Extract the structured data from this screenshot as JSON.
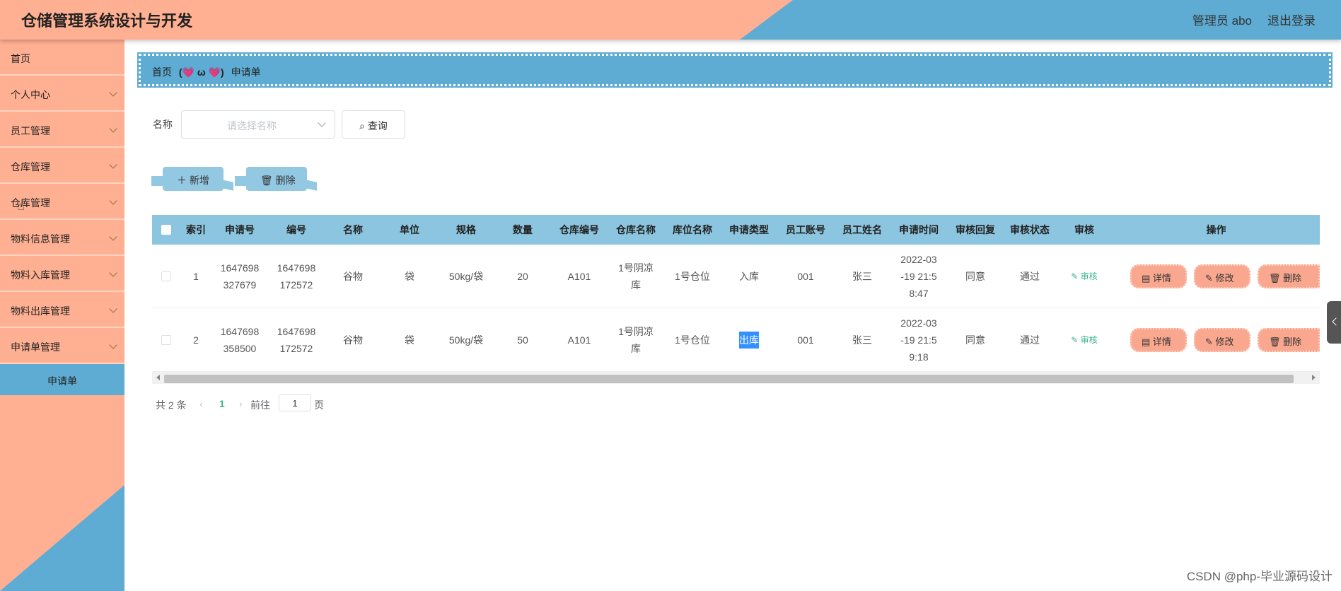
{
  "header": {
    "title": "仓储管理系统设计与开发",
    "user": "管理员 abo",
    "logout": "退出登录"
  },
  "sidebar": {
    "items": [
      {
        "label": "首页",
        "chevron": false
      },
      {
        "label": "个人中心",
        "chevron": true
      },
      {
        "label": "员工管理",
        "chevron": true
      },
      {
        "label": "仓库管理",
        "chevron": true
      },
      {
        "label": "仓库管理",
        "chevron": true
      },
      {
        "label": "物料信息管理",
        "chevron": true
      },
      {
        "label": "物料入库管理",
        "chevron": true
      },
      {
        "label": "物料出库管理",
        "chevron": true
      },
      {
        "label": "申请单管理",
        "chevron": true
      }
    ],
    "active_sub": "申请单"
  },
  "breadcrumb": {
    "home": "首页",
    "face": "(💗 ω 💗)",
    "current": "申请单"
  },
  "search": {
    "label": "名称",
    "placeholder": "请选择名称",
    "query_button": "查询"
  },
  "actions": {
    "add": "新增",
    "delete": "删除"
  },
  "table": {
    "headers": [
      "索引",
      "申请号",
      "编号",
      "名称",
      "单位",
      "规格",
      "数量",
      "仓库编号",
      "仓库名称",
      "库位名称",
      "申请类型",
      "员工账号",
      "员工姓名",
      "申请时间",
      "审核回复",
      "审核状态",
      "审核",
      "操作"
    ],
    "rows": [
      {
        "index": "1",
        "apply_no": [
          "1647698",
          "327679"
        ],
        "code": [
          "1647698",
          "172572"
        ],
        "name": "谷物",
        "unit": "袋",
        "spec": "50kg/袋",
        "qty": "20",
        "wh_code": "A101",
        "wh_name": [
          "1号阴凉",
          "库"
        ],
        "loc": "1号仓位",
        "type": "入库",
        "emp_acc": "001",
        "emp_name": "张三",
        "time": [
          "2022-03",
          "-19 21:5",
          "8:47"
        ],
        "reply": "同意",
        "status": "通过",
        "audit": "审核"
      },
      {
        "index": "2",
        "apply_no": [
          "1647698",
          "358500"
        ],
        "code": [
          "1647698",
          "172572"
        ],
        "name": "谷物",
        "unit": "袋",
        "spec": "50kg/袋",
        "qty": "50",
        "wh_code": "A101",
        "wh_name": [
          "1号阴凉",
          "库"
        ],
        "loc": "1号仓位",
        "type": "出库",
        "emp_acc": "001",
        "emp_name": "张三",
        "time": [
          "2022-03",
          "-19 21:5",
          "9:18"
        ],
        "reply": "同意",
        "status": "通过",
        "audit": "审核"
      }
    ],
    "op_buttons": {
      "detail": "详情",
      "edit": "修改",
      "delete": "删除"
    }
  },
  "pager": {
    "total": "共 2 条",
    "page": "1",
    "goto": "前往",
    "goto_value": "1",
    "suffix": "页"
  },
  "watermark": "CSDN @php-毕业源码设计"
}
